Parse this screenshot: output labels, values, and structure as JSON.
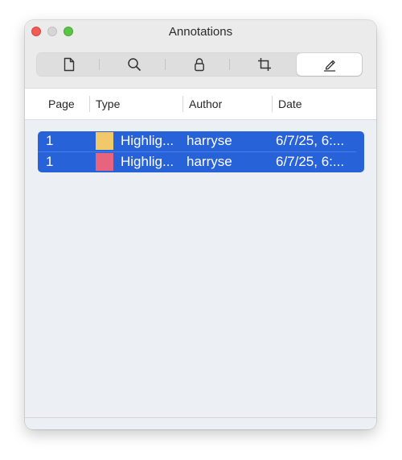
{
  "window": {
    "title": "Annotations"
  },
  "toolbar": {
    "segments": [
      {
        "icon": "document-icon",
        "selected": false
      },
      {
        "icon": "search-icon",
        "selected": false
      },
      {
        "icon": "lock-icon",
        "selected": false
      },
      {
        "icon": "crop-icon",
        "selected": false
      },
      {
        "icon": "pencil-icon",
        "selected": true
      }
    ]
  },
  "table": {
    "columns": [
      "Page",
      "Type",
      "Author",
      "Date"
    ],
    "rows": [
      {
        "page": "1",
        "color": "#f2c96a",
        "type": "Highlig...",
        "author": "harryse",
        "date": "6/7/25, 6:..."
      },
      {
        "page": "1",
        "color": "#e8637e",
        "type": "Highlig...",
        "author": "harryse",
        "date": "6/7/25, 6:..."
      }
    ]
  },
  "colors": {
    "selection": "#2862d8",
    "close": "#ee5c55",
    "maximize": "#5ac444"
  }
}
